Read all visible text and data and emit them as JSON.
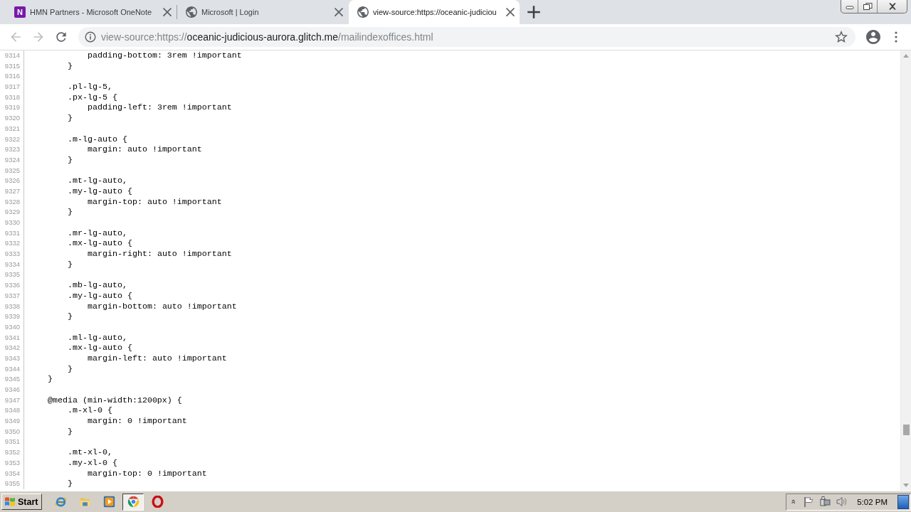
{
  "tabs": [
    {
      "kind": "tile",
      "icon_letter": "N",
      "title": "HMN Partners - Microsoft OneNote",
      "selected": false
    },
    {
      "kind": "globe",
      "title": "Microsoft | Login",
      "selected": false
    },
    {
      "kind": "globe",
      "title": "view-source:https://oceanic-judiciou",
      "selected": true
    }
  ],
  "address_bar": {
    "url": {
      "prefix": "view-source:https://",
      "host": "oceanic-judicious-aurora.glitch.me",
      "path": "/mailindexoffices.html"
    }
  },
  "source_lines": [
    {
      "number": "9314",
      "text": "            padding-bottom: 3rem !important"
    },
    {
      "number": "9315",
      "text": "        }"
    },
    {
      "number": "9316"
    },
    {
      "number": "9317",
      "text": "        .pl-lg-5,"
    },
    {
      "number": "9318",
      "text": "        .px-lg-5 {"
    },
    {
      "number": "9319",
      "text": "            padding-left: 3rem !important"
    },
    {
      "number": "9320",
      "text": "        }"
    },
    {
      "number": "9321"
    },
    {
      "number": "9322",
      "text": "        .m-lg-auto {"
    },
    {
      "number": "9323",
      "text": "            margin: auto !important"
    },
    {
      "number": "9324",
      "text": "        }"
    },
    {
      "number": "9325"
    },
    {
      "number": "9326",
      "text": "        .mt-lg-auto,"
    },
    {
      "number": "9327",
      "text": "        .my-lg-auto {"
    },
    {
      "number": "9328",
      "text": "            margin-top: auto !important"
    },
    {
      "number": "9329",
      "text": "        }"
    },
    {
      "number": "9330"
    },
    {
      "number": "9331",
      "text": "        .mr-lg-auto,"
    },
    {
      "number": "9332",
      "text": "        .mx-lg-auto {"
    },
    {
      "number": "9333",
      "text": "            margin-right: auto !important"
    },
    {
      "number": "9334",
      "text": "        }"
    },
    {
      "number": "9335"
    },
    {
      "number": "9336",
      "text": "        .mb-lg-auto,"
    },
    {
      "number": "9337",
      "text": "        .my-lg-auto {"
    },
    {
      "number": "9338",
      "text": "            margin-bottom: auto !important"
    },
    {
      "number": "9339",
      "text": "        }"
    },
    {
      "number": "9340"
    },
    {
      "number": "9341",
      "text": "        .ml-lg-auto,"
    },
    {
      "number": "9342",
      "text": "        .mx-lg-auto {"
    },
    {
      "number": "9343",
      "text": "            margin-left: auto !important"
    },
    {
      "number": "9344",
      "text": "        }"
    },
    {
      "number": "9345",
      "text": "    }"
    },
    {
      "number": "9346"
    },
    {
      "number": "9347",
      "text": "    @media (min-width:1200px) {"
    },
    {
      "number": "9348",
      "text": "        .m-xl-0 {"
    },
    {
      "number": "9349",
      "text": "            margin: 0 !important"
    },
    {
      "number": "9350",
      "text": "        }"
    },
    {
      "number": "9351"
    },
    {
      "number": "9352",
      "text": "        .mt-xl-0,"
    },
    {
      "number": "9353",
      "text": "        .my-xl-0 {"
    },
    {
      "number": "9354",
      "text": "            margin-top: 0 !important"
    },
    {
      "number": "9355",
      "text": "        }"
    }
  ],
  "taskbar": {
    "start": "Start",
    "apps": [
      {
        "kind": "e-logo",
        "selected": false
      },
      {
        "kind": "folder",
        "selected": false
      },
      {
        "kind": "play",
        "selected": false
      },
      {
        "kind": "ring-logo",
        "selected": true
      },
      {
        "kind": "o-logo",
        "selected": false
      }
    ],
    "clock": "5:02 PM"
  }
}
